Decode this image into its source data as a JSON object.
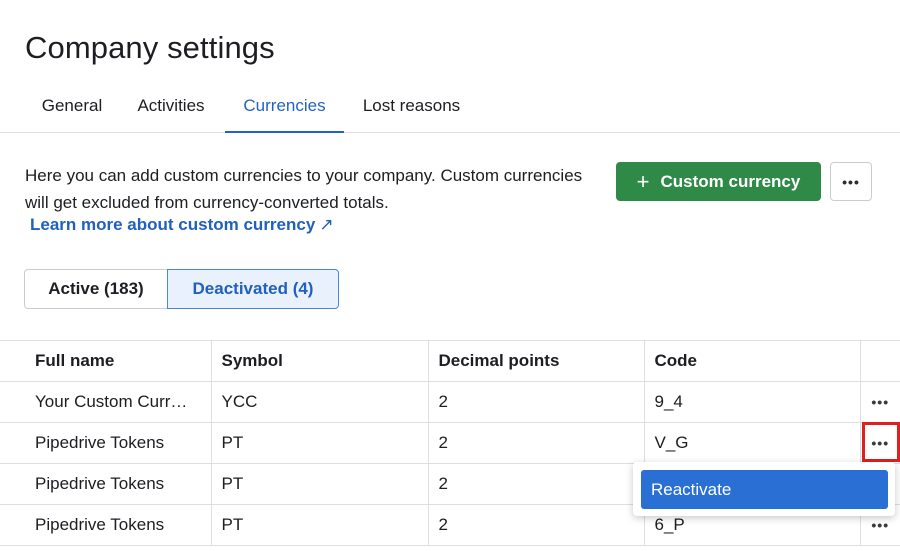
{
  "page": {
    "title": "Company settings"
  },
  "tabs": [
    {
      "label": "General"
    },
    {
      "label": "Activities"
    },
    {
      "label": "Currencies",
      "active": true
    },
    {
      "label": "Lost reasons"
    }
  ],
  "intro": {
    "text": "Here you can add custom currencies to your company. Custom currencies will get excluded from currency-converted totals.",
    "link_label": "Learn more about custom currency",
    "link_icon": "external-arrow-icon"
  },
  "actions": {
    "add_label": "Custom currency",
    "add_icon": "plus-icon",
    "more_icon": "more-icon"
  },
  "filter": {
    "active_label": "Active (183)",
    "deactivated_label": "Deactivated (4)",
    "selected": "deactivated"
  },
  "table": {
    "columns": [
      "Full name",
      "Symbol",
      "Decimal points",
      "Code"
    ],
    "rows": [
      {
        "name": "Your Custom Curr…",
        "symbol": "YCC",
        "decimals": "2",
        "code": "9_4"
      },
      {
        "name": "Pipedrive Tokens",
        "symbol": "PT",
        "decimals": "2",
        "code": "V_G"
      },
      {
        "name": "Pipedrive Tokens",
        "symbol": "PT",
        "decimals": "2",
        "code": ""
      },
      {
        "name": "Pipedrive Tokens",
        "symbol": "PT",
        "decimals": "2",
        "code": "6_P"
      }
    ]
  },
  "menu": {
    "reactivate_label": "Reactivate"
  },
  "colors": {
    "accent": "#2363c4",
    "primary_button": "#2f8a48",
    "highlight": "#e0201c",
    "menu_item": "#2a6fd3"
  }
}
